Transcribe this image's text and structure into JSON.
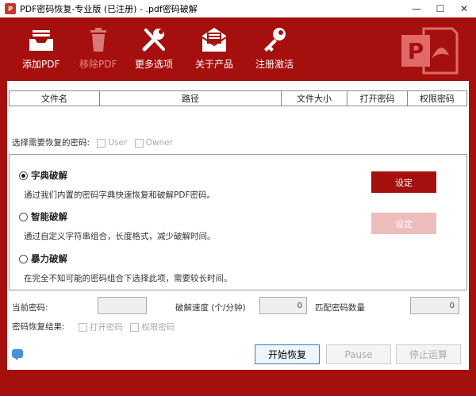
{
  "window": {
    "title": "PDF密码恢复-专业版 (已注册) - .pdf密码破解",
    "app_icon_text": "P",
    "controls": [
      "minimize",
      "maximize",
      "close"
    ]
  },
  "toolbar": {
    "add_pdf": "添加PDF",
    "remove_pdf": "移除PDF",
    "more_options": "更多选项",
    "about": "关于产品",
    "register": "注册激活"
  },
  "table": {
    "columns": [
      "文件名",
      "路径",
      "文件大小",
      "打开密码",
      "权限密码"
    ]
  },
  "password_select": {
    "label": "选择需要恢复的密码:",
    "user": "User",
    "owner": "Owner"
  },
  "modes": {
    "dictionary": {
      "title": "字典破解",
      "desc": "通过我们内置的密码字典快速恢复和破解PDF密码。",
      "selected": true
    },
    "smart": {
      "title": "智能破解",
      "desc": "通过自定义字符串组合，长度格式，减少破解时间。",
      "selected": false
    },
    "brute": {
      "title": "暴力破解",
      "desc": "在完全不知可能的密码组合下选择此项，需要较长时间。",
      "selected": false
    },
    "set_label": "设定"
  },
  "status": {
    "current_password_label": "当前密码:",
    "current_password": "",
    "speed_label": "破解速度 (个/分钟)",
    "speed": "0",
    "matched_label": "匹配密码数量",
    "matched": "0",
    "result_label": "密码恢复结果:",
    "open_pw": "打开密码",
    "perm_pw": "权限密码"
  },
  "actions": {
    "start": "开始恢复",
    "pause": "Pause",
    "stop": "停止运算"
  },
  "colors": {
    "brand_red": "#a5100f",
    "button_red": "#a5100f",
    "button_disabled": "#ecbdbc"
  }
}
